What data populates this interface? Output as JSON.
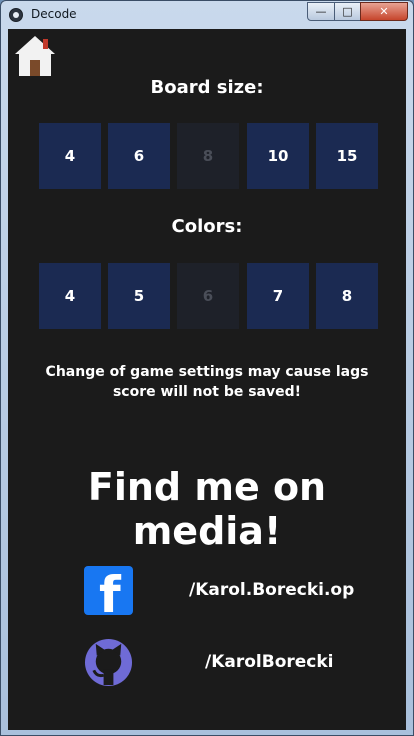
{
  "window": {
    "title": "Decode",
    "minimize": "—",
    "maximize": "□",
    "close": "✕"
  },
  "icons": {
    "app": "app-icon",
    "home": "home-icon",
    "facebook": "facebook-icon",
    "github": "github-icon"
  },
  "board": {
    "label": "Board size:",
    "options": [
      "4",
      "6",
      "8",
      "10",
      "15"
    ],
    "selected": "8"
  },
  "colors": {
    "label": "Colors:",
    "options": [
      "4",
      "5",
      "6",
      "7",
      "8"
    ],
    "selected": "6"
  },
  "note": {
    "line1": "Change of game settings may cause lags",
    "line2": "score will not be saved!"
  },
  "media": {
    "heading": "Find me on media!",
    "facebook": {
      "glyph": "f",
      "handle": "/Karol.Borecki.op"
    },
    "github": {
      "handle": "/KarolBorecki"
    }
  },
  "palette": {
    "tile": "#1b2a52",
    "tile_selected": "#1e2129",
    "background": "#1b1b1b",
    "facebook": "#1877f2",
    "github": "#6f6bd6"
  }
}
